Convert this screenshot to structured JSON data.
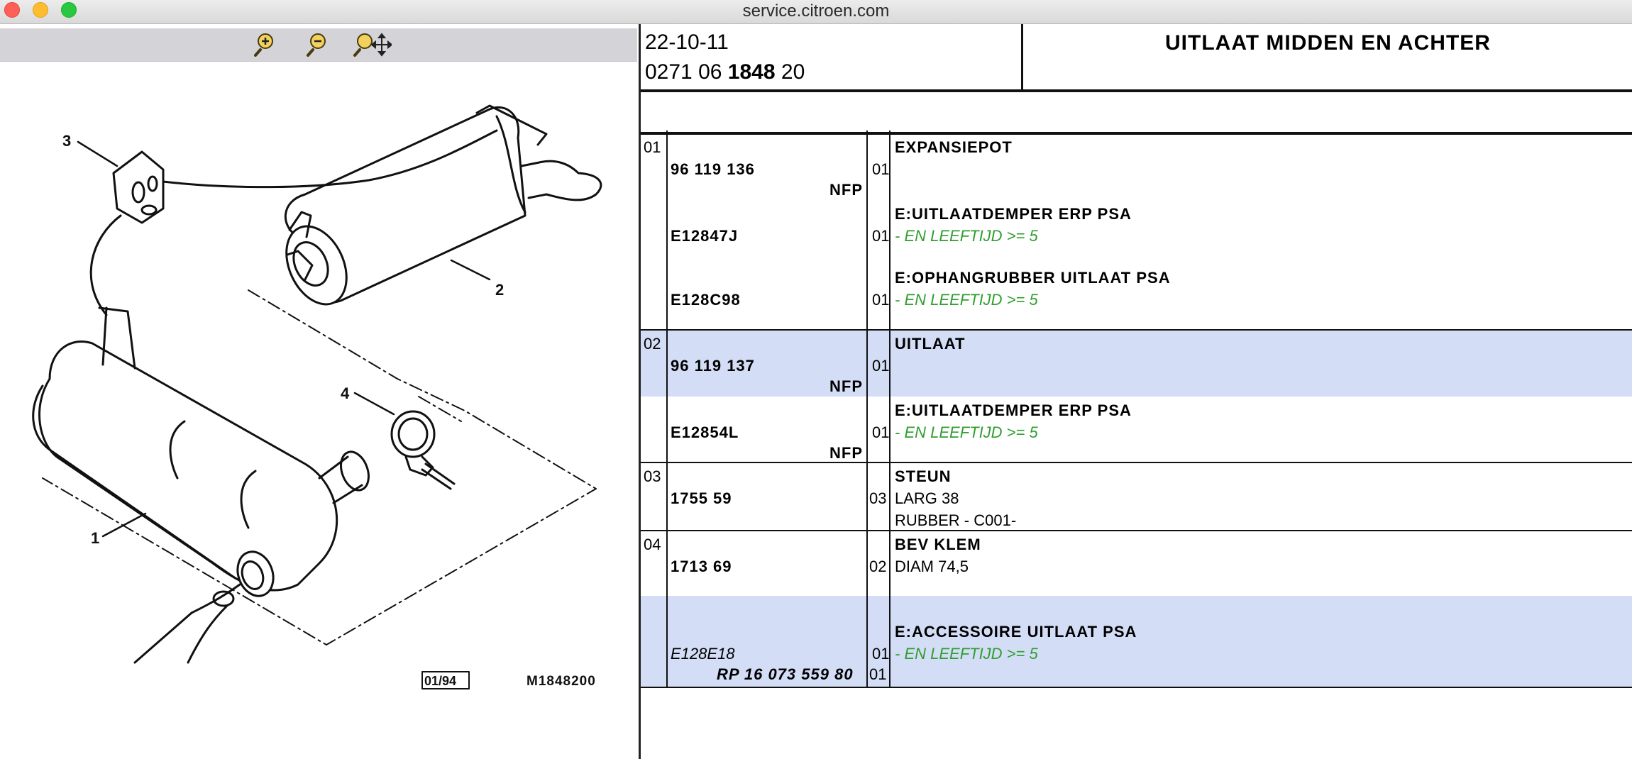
{
  "window": {
    "title": "service.citroen.com"
  },
  "toolbar": {
    "zoom_in": "zoom-in",
    "zoom_out": "zoom-out",
    "pan": "zoom-pan"
  },
  "drawing": {
    "callouts": [
      "1",
      "2",
      "3",
      "4"
    ],
    "date_box": "01/94",
    "ref": "M1848200"
  },
  "header": {
    "date": "22-10-11",
    "ref_prefix": "0271 06",
    "ref_bold": "1848",
    "ref_suffix": "20",
    "title": "UITLAAT MIDDEN EN ACHTER"
  },
  "groups": [
    {
      "pos": "01",
      "rows": [
        {
          "ref": "96 119 136",
          "note": "NFP",
          "qty": "01",
          "desc": "EXPANSIEPOT",
          "details": []
        },
        {
          "ref": "E12847J",
          "note": "",
          "qty": "01",
          "desc": "E:UITLAATDEMPER ERP PSA",
          "details": [
            "- EN LEEFTIJD >= 5"
          ]
        },
        {
          "ref": "E128C98",
          "note": "",
          "qty": "01",
          "desc": "E:OPHANGRUBBER UITLAAT PSA",
          "details": [
            "- EN LEEFTIJD >= 5"
          ]
        }
      ]
    },
    {
      "pos": "02",
      "rows": [
        {
          "ref": "96 119 137",
          "note": "NFP",
          "qty": "01",
          "desc": "UITLAAT",
          "details": []
        },
        {
          "ref": "E12854L",
          "note": "NFP",
          "qty": "01",
          "desc": "E:UITLAATDEMPER ERP PSA",
          "details": [
            "- EN LEEFTIJD >= 5"
          ]
        }
      ]
    },
    {
      "pos": "03",
      "rows": [
        {
          "ref": "1755 59",
          "note": "",
          "qty": "03",
          "desc": "STEUN",
          "details": [
            "LARG 38",
            "RUBBER - C001-"
          ]
        }
      ]
    },
    {
      "pos": "04",
      "rows": [
        {
          "ref": "1713 69",
          "note": "",
          "qty": "02",
          "desc": "BEV KLEM",
          "details": [
            "DIAM 74,5"
          ]
        },
        {
          "ref": "E128E18",
          "note": "RP 16 073 559 80",
          "qty": "01",
          "qty2": "01",
          "desc": "E:ACCESSOIRE UITLAAT PSA",
          "details": [
            "- EN LEEFTIJD >= 5"
          ]
        }
      ]
    }
  ]
}
